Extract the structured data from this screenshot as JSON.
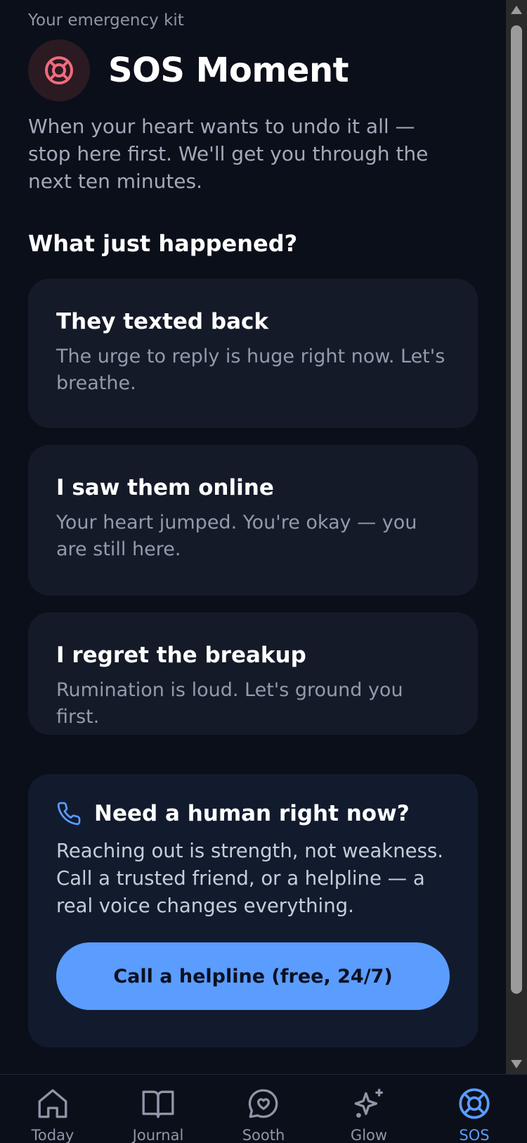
{
  "header": {
    "kicker": "Your emergency kit",
    "title": "SOS Moment",
    "intro": "When your heart wants to undo it all — stop here first. We'll get you through the next ten minutes."
  },
  "section": {
    "heading": "What just happened?"
  },
  "scenarios": [
    {
      "title": "They texted back",
      "subtitle": "The urge to reply is huge right now. Let's breathe."
    },
    {
      "title": "I saw them online",
      "subtitle": "Your heart jumped. You're okay — you are still here."
    },
    {
      "title": "I regret the breakup",
      "subtitle": "Rumination is loud. Let's ground you first."
    }
  ],
  "help": {
    "title": "Need a human right now?",
    "body": "Reaching out is strength, not weakness. Call a trusted friend, or a helpline — a real voice changes everything.",
    "button_label": "Call a helpline (free, 24/7)"
  },
  "nav": {
    "items": [
      {
        "label": "Today",
        "icon": "home-icon"
      },
      {
        "label": "Journal",
        "icon": "book-icon"
      },
      {
        "label": "Sooth",
        "icon": "chat-heart-icon"
      },
      {
        "label": "Glow",
        "icon": "sparkle-icon"
      },
      {
        "label": "SOS",
        "icon": "lifebuoy-icon",
        "active": true
      }
    ]
  },
  "colors": {
    "background": "#0b0f19",
    "card": "#151a29",
    "help_card": "#121b2e",
    "accent": "#5b9cff",
    "sos_icon": "#f06b7c"
  }
}
